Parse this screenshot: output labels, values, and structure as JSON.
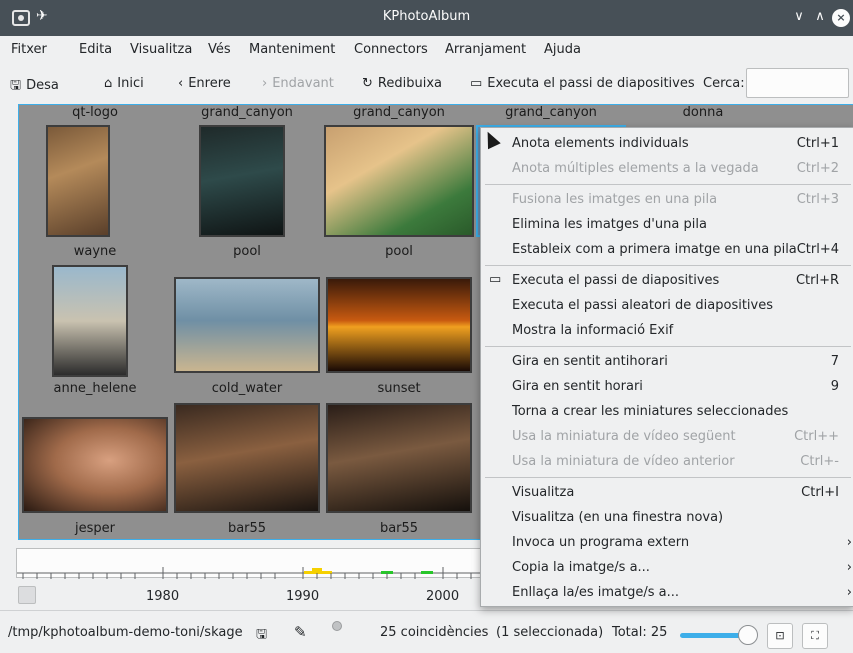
{
  "window": {
    "title": "KPhotoAlbum",
    "min_glyph": "∨",
    "max_glyph": "∧",
    "close_glyph": "×"
  },
  "menubar": [
    "Fitxer",
    "Edita",
    "Visualitza",
    "Vés",
    "Manteniment",
    "Connectors",
    "Arranjament",
    "Ajuda"
  ],
  "toolbar": {
    "save": "Desa",
    "home": "Inici",
    "back": "Enrere",
    "forward": "Endavant",
    "redraw": "Redibuixa",
    "slideshow": "Executa el passi de diapositives",
    "search_label": "Cerca:",
    "search_value": ""
  },
  "thumbnails": {
    "row1_labels": [
      "qt-logo",
      "grand_canyon",
      "grand_canyon",
      "grand_canyon",
      "donna"
    ],
    "row2_labels": [
      "wayne",
      "pool",
      "pool"
    ],
    "row3_labels": [
      "anne_helene",
      "cold_water",
      "sunset"
    ],
    "row4_labels": [
      "jesper",
      "bar55",
      "bar55"
    ]
  },
  "timeline": {
    "years": [
      "1980",
      "1990",
      "2000"
    ]
  },
  "status": {
    "path": "/tmp/kphotoalbum-demo-toni/skage",
    "matches": "25 coincidències",
    "selected": "(1 seleccionada)",
    "total": "Total: 25",
    "thumb_size_fraction": 0.9
  },
  "context_menu": {
    "items": [
      {
        "label": "Anota elements individuals",
        "shortcut": "Ctrl+1",
        "enabled": true
      },
      {
        "label": "Anota múltiples elements a la vegada",
        "shortcut": "Ctrl+2",
        "enabled": false
      },
      {
        "label": "Fusiona les imatges en una pila",
        "shortcut": "Ctrl+3",
        "enabled": false
      },
      {
        "label": "Elimina les imatges d'una pila",
        "shortcut": "",
        "enabled": true
      },
      {
        "label": "Estableix com a primera imatge en una pila",
        "shortcut": "Ctrl+4",
        "enabled": true
      },
      {
        "label": "Executa el passi de diapositives",
        "shortcut": "Ctrl+R",
        "enabled": true
      },
      {
        "label": "Executa el passi aleatori de diapositives",
        "shortcut": "",
        "enabled": true
      },
      {
        "label": "Mostra la informació Exif",
        "shortcut": "",
        "enabled": true
      },
      {
        "label": "Gira en sentit antihorari",
        "shortcut": "7",
        "enabled": true
      },
      {
        "label": "Gira en sentit horari",
        "shortcut": "9",
        "enabled": true
      },
      {
        "label": "Torna a crear les miniatures seleccionades",
        "shortcut": "",
        "enabled": true
      },
      {
        "label": "Usa la miniatura de vídeo següent",
        "shortcut": "Ctrl++",
        "enabled": false
      },
      {
        "label": "Usa la miniatura de vídeo anterior",
        "shortcut": "Ctrl+-",
        "enabled": false
      },
      {
        "label": "Visualitza",
        "shortcut": "Ctrl+I",
        "enabled": true
      },
      {
        "label": "Visualitza (en una finestra nova)",
        "shortcut": "",
        "enabled": true
      },
      {
        "label": "Invoca un programa extern",
        "shortcut": "",
        "enabled": true
      },
      {
        "label": "Copia la imatge/s a...",
        "shortcut": "",
        "enabled": true
      },
      {
        "label": "Enllaça la/es imatge/s a...",
        "shortcut": "",
        "enabled": true
      }
    ],
    "submenu_arrow": "›"
  },
  "colors": {
    "accent": "#3daee9",
    "titlebar": "#475057",
    "disabled": "#a0a3a6"
  }
}
